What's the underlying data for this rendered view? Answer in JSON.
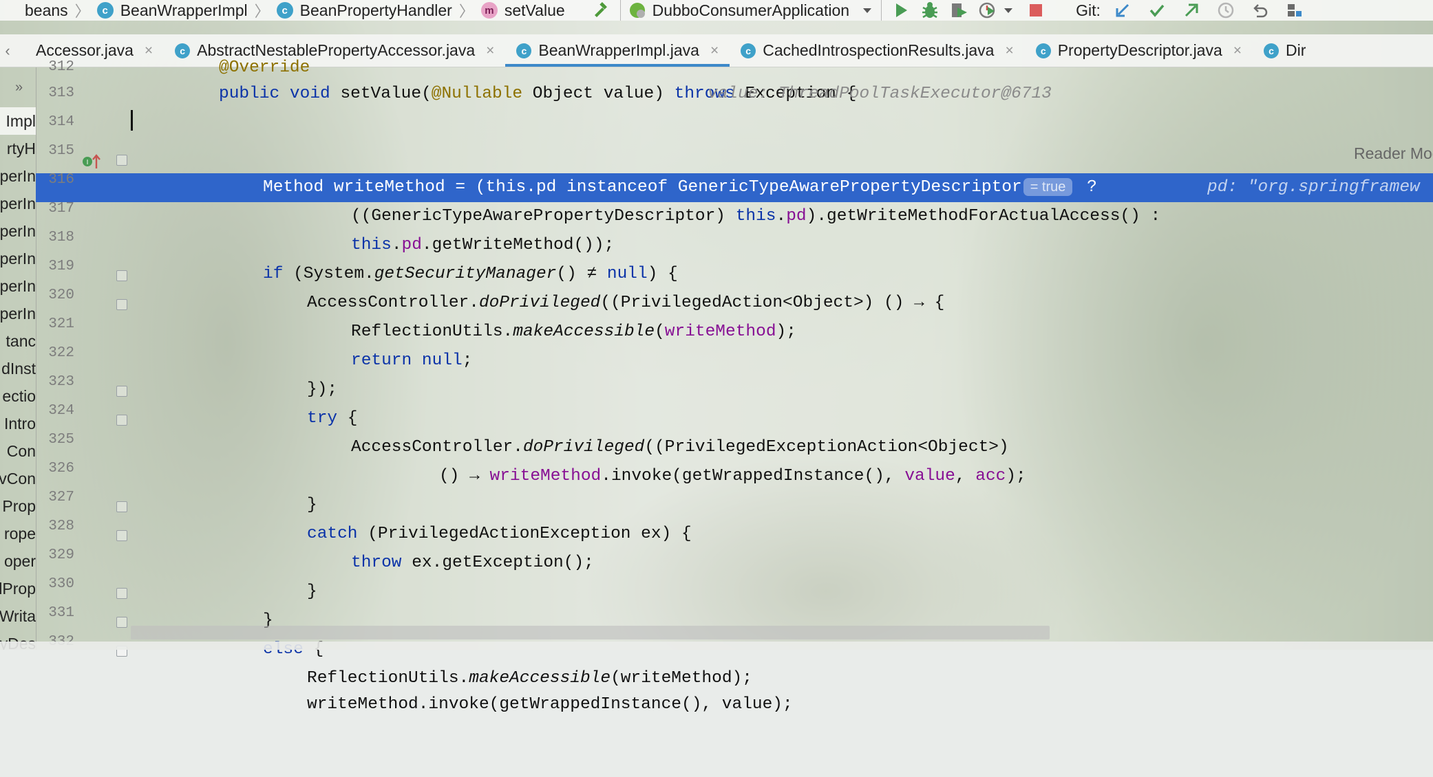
{
  "breadcrumb": {
    "items": [
      {
        "label": "beans",
        "icon": "none"
      },
      {
        "label": "BeanWrapperImpl",
        "icon": "class-icon"
      },
      {
        "label": "BeanPropertyHandler",
        "icon": "class-icon"
      },
      {
        "label": "setValue",
        "icon": "method-icon"
      }
    ],
    "class_icon_letter": "c",
    "method_icon_letter": "m"
  },
  "toolbar": {
    "run_config": "DubboConsumerApplication",
    "git_label": "Git:"
  },
  "tabs": [
    {
      "label": "Accessor.java",
      "active": false
    },
    {
      "label": "AbstractNestablePropertyAccessor.java",
      "active": false
    },
    {
      "label": "BeanWrapperImpl.java",
      "active": true
    },
    {
      "label": "CachedIntrospectionResults.java",
      "active": false
    },
    {
      "label": "PropertyDescriptor.java",
      "active": false
    },
    {
      "label": "Dir",
      "active": false
    }
  ],
  "tab_close_glyph": "×",
  "project": {
    "expand_glyph": "»",
    "items": [
      "Impl",
      "rtyH",
      "perIn",
      "perIn",
      "perIn",
      "perIn",
      "perIn",
      "perIn",
      "tanc",
      "dInst",
      "ectio",
      "Intro",
      "Con",
      "vCon",
      "Prop",
      "rope",
      "oper",
      "dProp",
      "Writa",
      "yDes"
    ]
  },
  "editor": {
    "reader_mode": "Reader Mode",
    "lines": [
      {
        "no": "312",
        "text": "@Override"
      },
      {
        "no": "313"
      },
      {
        "no": "314"
      },
      {
        "no": "315"
      },
      {
        "no": "316"
      },
      {
        "no": "317"
      },
      {
        "no": "318"
      },
      {
        "no": "319"
      },
      {
        "no": "320"
      },
      {
        "no": "321"
      },
      {
        "no": "322"
      },
      {
        "no": "323"
      },
      {
        "no": "324"
      },
      {
        "no": "325"
      },
      {
        "no": "326"
      },
      {
        "no": "327"
      },
      {
        "no": "328"
      },
      {
        "no": "329"
      },
      {
        "no": "330"
      },
      {
        "no": "331"
      },
      {
        "no": "332",
        "text": "writeMethod.invoke(getWrappedInstance(), value);"
      }
    ],
    "hints": {
      "line313": "value: ThreadPoolTaskExecutor@6713",
      "line314_badge": "= true",
      "line314": "pd: \"org.springframew"
    },
    "tokens": {
      "public": "public",
      "void": "void",
      "setValue": "setValue",
      "paren_open": "(",
      "nullable": "@Nullable",
      "object_value": " Object value) ",
      "throws": "throws",
      "exception_brace": " Exception {",
      "method_wm": "Method writeMethod = (this.pd instanceof GenericTypeAwarePropertyDescriptor",
      "q": " ?",
      "l315a": "((GenericTypeAwarePropertyDescriptor) ",
      "this": "this",
      "dot": ".",
      "pd": "pd",
      "l315b": ").getWriteMethodForActualAccess() :",
      "l316b": ".getWriteMethod());",
      "if": "if",
      "l317a": " (System.",
      "getSecurityManager": "getSecurityManager",
      "l317b": "() ≠ ",
      "null": "null",
      "l317c": ") {",
      "l318a": "AccessController.",
      "doPrivileged": "doPrivileged",
      "l318b": "((PrivilegedAction<Object>) () → {",
      "l319a": "ReflectionUtils.",
      "makeAccessible": "makeAccessible",
      "l319b": "(",
      "writeMethod": "writeMethod",
      "l319c": ");",
      "return": "return",
      "l320b": ";",
      "l321": "});",
      "try": "try",
      "l322b": " {",
      "l323b": "((PrivilegedExceptionAction<Object>)",
      "l324a": "() → ",
      "l324b": ".invoke(getWrappedInstance(), ",
      "value": "value",
      "comma": ", ",
      "acc": "acc",
      "l324c": ");",
      "l325": "}",
      "catch": "catch",
      "l326b": " (PrivilegedActionException ex) {",
      "throw": "throw",
      "l327b": " ex.getException();",
      "l328": "}",
      "l329": "}",
      "else": "else",
      "l330b": " {",
      "l331b": "(writeMethod);"
    }
  },
  "colors": {
    "keyword": "#0b33a8",
    "annotation": "#8d7100",
    "field": "#871094",
    "selection": "#2f65ca",
    "tab_underline": "#3d89c9",
    "class_icon": "#3fa1c9"
  },
  "icons": [
    "hammer-icon",
    "run-icon",
    "debug-icon",
    "coverage-icon",
    "profile-icon",
    "more-dropdown-icon",
    "stop-icon",
    "git-update-icon",
    "git-commit-icon",
    "git-push-icon",
    "git-history-icon",
    "rollback-icon",
    "structure-icon",
    "override-method-icon"
  ]
}
